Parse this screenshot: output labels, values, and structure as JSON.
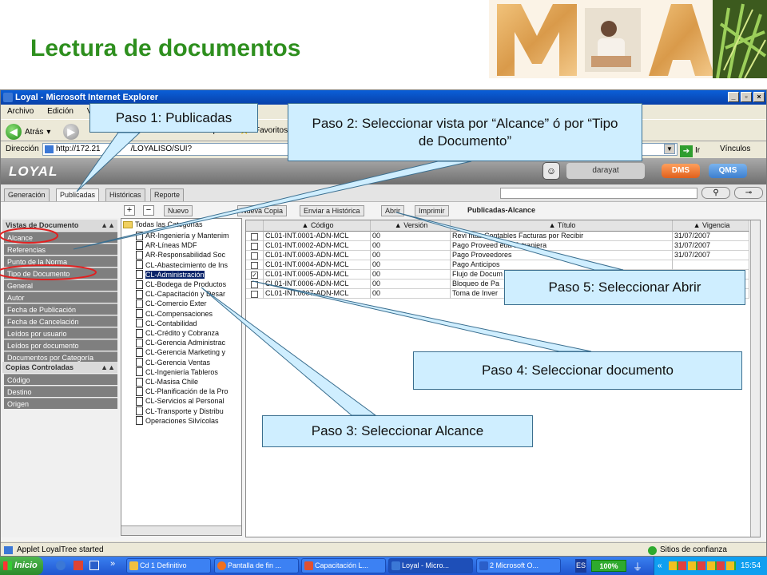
{
  "slide": {
    "title": "Lectura de documentos",
    "logo_colors": [
      "#e7a95a",
      "#c58a38",
      "#6a7a2a"
    ]
  },
  "window": {
    "title": "Loyal - Microsoft Internet Explorer",
    "menu": [
      "Archivo",
      "Edición",
      "V"
    ],
    "back_label": "Atrás",
    "address_label": "Dirección",
    "address_url": "http://172.21",
    "address_url_tail": "/LOYALISO/SUI?",
    "go_label": "Ir",
    "links_label": "Vínculos",
    "search_label": "Búsqueda",
    "favorites_label": "Favoritos"
  },
  "app": {
    "logo": "LOYAL",
    "user": "darayat",
    "dms": "DMS",
    "qms": "QMS",
    "tabs": [
      "Generación",
      "Publicadas",
      "Históricas",
      "Reporte"
    ],
    "toolbar": {
      "nuevo": "Nuevo",
      "nueva_copia": "Nueva Copia",
      "enviar": "Enviar a Histórica",
      "abrir": "Abrir",
      "imprimir": "Imprimir",
      "view_label": "Publicadas-Alcance"
    },
    "left": {
      "section1": "Vistas de Documento",
      "section1_items": [
        "Alcance",
        "Referencias",
        "Punto de la Norma",
        "Tipo de Documento",
        "General",
        "Autor",
        "Fecha de Publicación",
        "Fecha de Cancelación",
        "Leídos por usuario",
        "Leídos por documento",
        "Documentos por Categoría"
      ],
      "section2": "Copias Controladas",
      "section2_items": [
        "Código",
        "Destino",
        "Origen"
      ]
    },
    "tree": {
      "root": "Todas las Categorías",
      "items": [
        "AR-Ingeniería y Mantenim",
        "AR-Líneas MDF",
        "AR-Responsabilidad Soc",
        "CL-Abastecimiento de Ins",
        "CL-Administración",
        "CL-Bodega de Productos",
        "CL-Capacitación y Desar",
        "CL-Comercio Exter",
        "CL-Compensaciones",
        "CL-Contabilidad",
        "CL-Crédito y Cobranza",
        "CL-Gerencia Administrac",
        "CL-Gerencia Marketing y",
        "CL-Gerencia Ventas",
        "CL-Ingeniería Tableros",
        "CL-Masisa Chile",
        "CL-Planificación de la Pro",
        "CL-Servicios al Personal",
        "CL-Transporte y Distribu",
        "Operaciones Silvícolas"
      ],
      "selected_index": 4
    },
    "grid": {
      "columns": [
        "Código",
        "Versión",
        "Título",
        "Vigencia"
      ],
      "rows": [
        {
          "codigo": "CL01-INT.0001-ADN-MCL",
          "version": "00",
          "titulo": "Revi        ntas Contables Facturas por Recibir",
          "vigencia": "31/07/2007",
          "checked": false
        },
        {
          "codigo": "CL01-INT.0002-ADN-MCL",
          "version": "00",
          "titulo": "Pago Proveed              eda Extranjera",
          "vigencia": "31/07/2007",
          "checked": false
        },
        {
          "codigo": "CL01-INT.0003-ADN-MCL",
          "version": "00",
          "titulo": "Pago Proveedores",
          "vigencia": "31/07/2007",
          "checked": false
        },
        {
          "codigo": "CL01-INT.0004-ADN-MCL",
          "version": "00",
          "titulo": "Pago Anticipos",
          "vigencia": "",
          "checked": false
        },
        {
          "codigo": "CL01-INT.0005-ADN-MCL",
          "version": "00",
          "titulo": "Flujo de Docum",
          "vigencia": "",
          "checked": true
        },
        {
          "codigo": "CL01-INT.0006-ADN-MCL",
          "version": "00",
          "titulo": "Bloqueo de Pa",
          "vigencia": "",
          "checked": false
        },
        {
          "codigo": "CL01-INT.0007-ADN-MCL",
          "version": "00",
          "titulo": "Toma de Inver",
          "vigencia": "",
          "checked": false
        }
      ]
    }
  },
  "status": {
    "text": "Applet LoyalTree started",
    "zone": "Sitios de confianza"
  },
  "taskbar": {
    "start": "Inicio",
    "tasks": [
      "Cd 1 Definitivo",
      "Pantalla de fin ...",
      "Capacitación L...",
      "Loyal - Micro...",
      "2 Microsoft O..."
    ],
    "lang": "ES",
    "battery": "100%",
    "clock": "15:54"
  },
  "callouts": {
    "paso1": "Paso 1: Publicadas",
    "paso2": "Paso 2: Seleccionar vista por “Alcance” ó por “Tipo de Documento”",
    "paso3": "Paso 3: Seleccionar Alcance",
    "paso4": "Paso 4: Seleccionar documento",
    "paso5": "Paso 5: Seleccionar Abrir",
    "fill_color": "#cfeeff",
    "highlight_color": "#e02020"
  }
}
